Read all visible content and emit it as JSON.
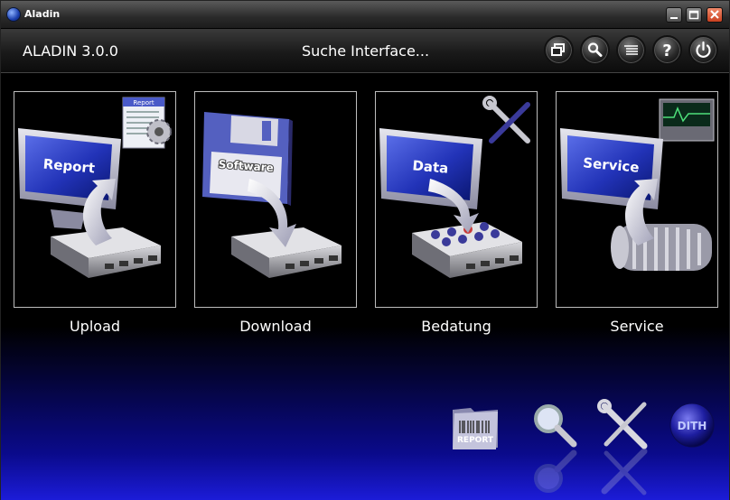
{
  "window": {
    "title": "Aladin"
  },
  "header": {
    "app_title": "ALADIN 3.0.0",
    "status": "Suche Interface..."
  },
  "tiles": [
    {
      "label": "Upload",
      "screen_text": "Report",
      "badge_text": "Report"
    },
    {
      "label": "Download",
      "screen_text": "Software"
    },
    {
      "label": "Bedatung",
      "screen_text": "Data"
    },
    {
      "label": "Service",
      "screen_text": "Service"
    }
  ],
  "bottom_icons": {
    "report_folder": "REPORT",
    "globe": "DITH"
  },
  "colors": {
    "bg_top": "#000000",
    "bg_bottom": "#1c1cd8",
    "close_button": "#d2502a"
  }
}
